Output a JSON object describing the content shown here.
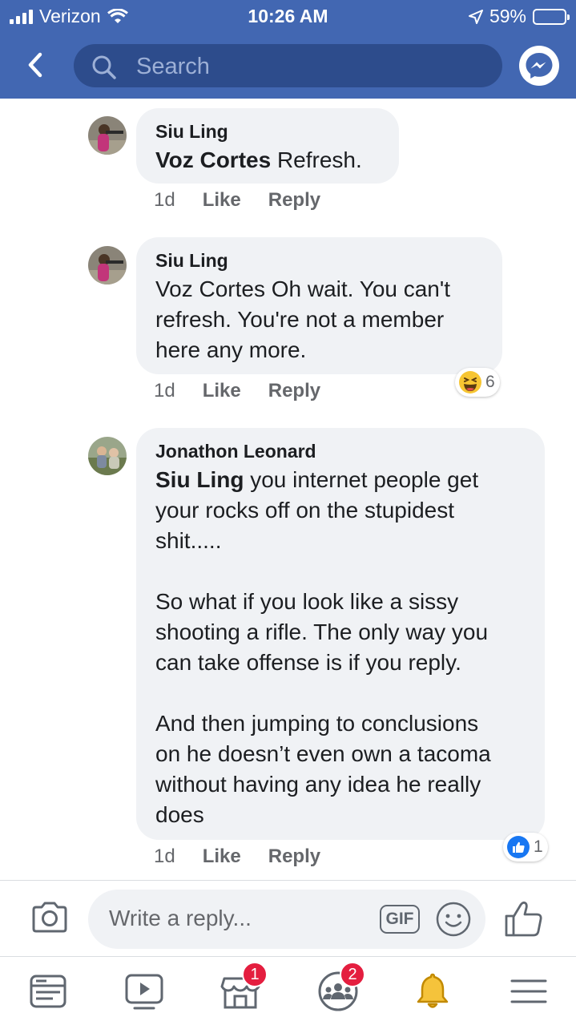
{
  "status_bar": {
    "carrier": "Verizon",
    "time": "10:26 AM",
    "battery": "59%",
    "battery_level": 0.59
  },
  "header": {
    "search_placeholder": "Search",
    "icons": [
      "back-arrow-icon",
      "search-icon",
      "messenger-icon"
    ]
  },
  "comments": [
    {
      "author": "Siu Ling",
      "mention": "Voz Cortes",
      "text": " Refresh.",
      "time": "1d",
      "like_label": "Like",
      "reply_label": "Reply"
    },
    {
      "author": "Siu Ling",
      "mention": "",
      "text": "Voz Cortes Oh wait. You can't\nrefresh.  You're not a member\nhere any more.",
      "time": "1d",
      "like_label": "Like",
      "reply_label": "Reply",
      "reaction": {
        "icon": "haha-icon",
        "count": "6"
      }
    },
    {
      "author": "Jonathon Leonard",
      "mention": "Siu Ling",
      "text": " you internet people get\nyour rocks off on the stupidest\nshit.....\n\nSo what if you look like a sissy\nshooting a rifle. The only way you\ncan take offense is if you reply.\n\nAnd then jumping to conclusions\non he doesn’t even own a tacoma\nwithout having any idea he really\ndoes",
      "time": "1d",
      "like_label": "Like",
      "reply_label": "Reply",
      "reaction": {
        "icon": "like-icon",
        "count": "1"
      }
    }
  ],
  "reply_bar": {
    "placeholder": "Write a reply...",
    "gif_label": "GIF"
  },
  "tabbar": {
    "tabs": [
      {
        "name": "news-feed",
        "badge": ""
      },
      {
        "name": "watch",
        "badge": ""
      },
      {
        "name": "marketplace",
        "badge": "1"
      },
      {
        "name": "groups",
        "badge": "2"
      },
      {
        "name": "notifications",
        "badge": ""
      },
      {
        "name": "menu",
        "badge": ""
      }
    ]
  },
  "colors": {
    "brand": "#4267b2",
    "bubble": "#f0f2f5",
    "badge": "#e41e3f",
    "notification_bell": "#f5c33b"
  }
}
